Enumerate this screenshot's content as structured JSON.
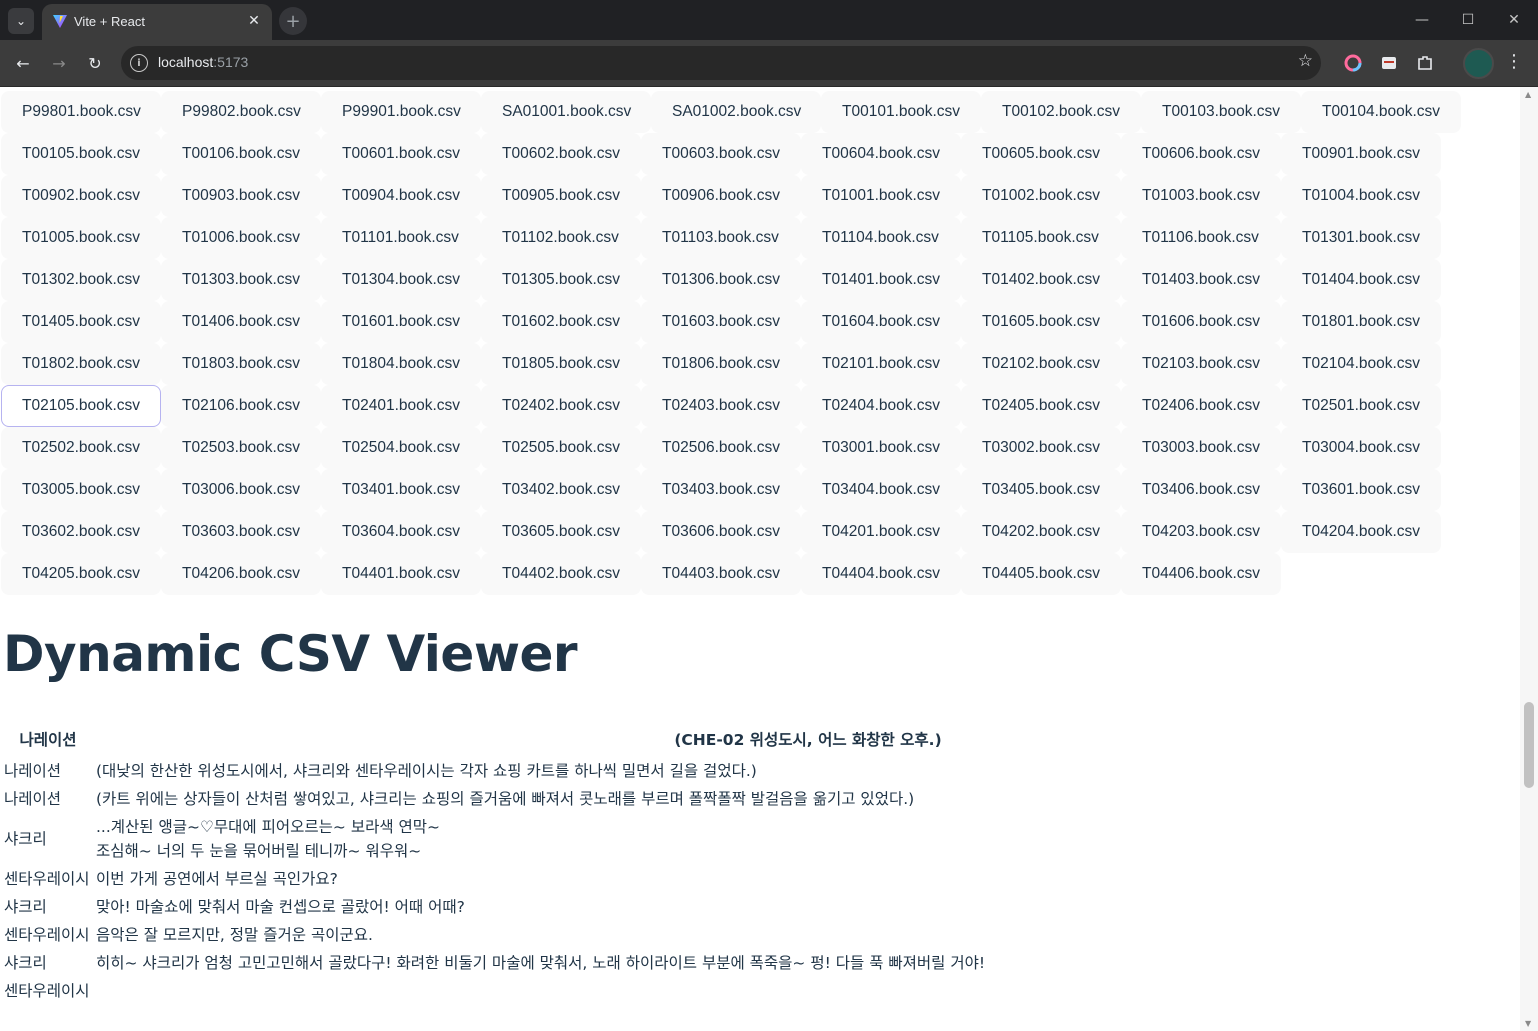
{
  "browser": {
    "tab_title": "Vite + React",
    "url_host": "localhost",
    "url_port": ":5173"
  },
  "files": [
    "P99801.book.csv",
    "P99802.book.csv",
    "P99901.book.csv",
    "SA01001.book.csv",
    "SA01002.book.csv",
    "T00101.book.csv",
    "T00102.book.csv",
    "T00103.book.csv",
    "T00104.book.csv",
    "T00105.book.csv",
    "T00106.book.csv",
    "T00601.book.csv",
    "T00602.book.csv",
    "T00603.book.csv",
    "T00604.book.csv",
    "T00605.book.csv",
    "T00606.book.csv",
    "T00901.book.csv",
    "T00902.book.csv",
    "T00903.book.csv",
    "T00904.book.csv",
    "T00905.book.csv",
    "T00906.book.csv",
    "T01001.book.csv",
    "T01002.book.csv",
    "T01003.book.csv",
    "T01004.book.csv",
    "T01005.book.csv",
    "T01006.book.csv",
    "T01101.book.csv",
    "T01102.book.csv",
    "T01103.book.csv",
    "T01104.book.csv",
    "T01105.book.csv",
    "T01106.book.csv",
    "T01301.book.csv",
    "T01302.book.csv",
    "T01303.book.csv",
    "T01304.book.csv",
    "T01305.book.csv",
    "T01306.book.csv",
    "T01401.book.csv",
    "T01402.book.csv",
    "T01403.book.csv",
    "T01404.book.csv",
    "T01405.book.csv",
    "T01406.book.csv",
    "T01601.book.csv",
    "T01602.book.csv",
    "T01603.book.csv",
    "T01604.book.csv",
    "T01605.book.csv",
    "T01606.book.csv",
    "T01801.book.csv",
    "T01802.book.csv",
    "T01803.book.csv",
    "T01804.book.csv",
    "T01805.book.csv",
    "T01806.book.csv",
    "T02101.book.csv",
    "T02102.book.csv",
    "T02103.book.csv",
    "T02104.book.csv",
    "T02105.book.csv",
    "T02106.book.csv",
    "T02401.book.csv",
    "T02402.book.csv",
    "T02403.book.csv",
    "T02404.book.csv",
    "T02405.book.csv",
    "T02406.book.csv",
    "T02501.book.csv",
    "T02502.book.csv",
    "T02503.book.csv",
    "T02504.book.csv",
    "T02505.book.csv",
    "T02506.book.csv",
    "T03001.book.csv",
    "T03002.book.csv",
    "T03003.book.csv",
    "T03004.book.csv",
    "T03005.book.csv",
    "T03006.book.csv",
    "T03401.book.csv",
    "T03402.book.csv",
    "T03403.book.csv",
    "T03404.book.csv",
    "T03405.book.csv",
    "T03406.book.csv",
    "T03601.book.csv",
    "T03602.book.csv",
    "T03603.book.csv",
    "T03604.book.csv",
    "T03605.book.csv",
    "T03606.book.csv",
    "T04201.book.csv",
    "T04202.book.csv",
    "T04203.book.csv",
    "T04204.book.csv",
    "T04205.book.csv",
    "T04206.book.csv",
    "T04401.book.csv",
    "T04402.book.csv",
    "T04403.book.csv",
    "T04404.book.csv",
    "T04405.book.csv",
    "T04406.book.csv"
  ],
  "focused_file": "T02105.book.csv",
  "viewer": {
    "title": "Dynamic CSV Viewer",
    "header": [
      "나레이션",
      "(CHE-02 위성도시, 어느 화창한 오후.)"
    ],
    "rows": [
      [
        "나레이션",
        "(대낮의 한산한 위성도시에서, 샤크리와 센타우레이시는 각자 쇼핑 카트를 하나씩 밀면서 길을 걸었다.)"
      ],
      [
        "나레이션",
        "(카트 위에는 상자들이 산처럼 쌓여있고, 샤크리는 쇼핑의 즐거움에 빠져서 콧노래를 부르며 폴짝폴짝 발걸음을 옮기고 있었다.)"
      ],
      [
        "샤크리",
        "...계산된 앵글~♡무대에 피어오르는~ 보라색 연막~\n조심해~ 너의 두 눈을 묶어버릴 테니까~ 워우워~"
      ],
      [
        "센타우레이시",
        "이번 가게 공연에서 부르실 곡인가요?"
      ],
      [
        "샤크리",
        "맞아! 마술쇼에 맞춰서 마술 컨셉으로 골랐어! 어때 어때?"
      ],
      [
        "센타우레이시",
        "음악은 잘 모르지만, 정말 즐거운 곡이군요."
      ],
      [
        "샤크리",
        "히히~ 샤크리가 엄청 고민고민해서 골랐다구! 화려한 비둘기 마술에 맞춰서, 노래 하이라이트 부분에 폭죽을~ 펑! 다들 푹 빠져버릴 거야!"
      ],
      [
        "센타우레이시",
        ""
      ]
    ]
  }
}
